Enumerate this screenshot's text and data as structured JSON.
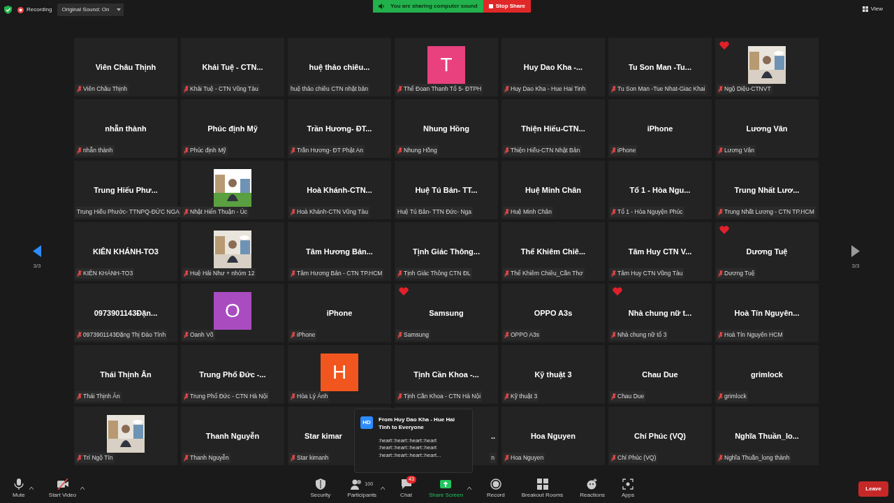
{
  "top_bar": {
    "recording": "Recording",
    "sound_menu": "Original Sound: On",
    "sharing_notice": "You are sharing computer sound",
    "stop_share": "Stop Share",
    "view": "View"
  },
  "pager": {
    "left": "3/3",
    "right": "3/3"
  },
  "tiles": [
    {
      "kind": "name",
      "name": "Viên Châu Thịnh",
      "label": "Viên Châu Thịnh",
      "muted": true,
      "heart": false
    },
    {
      "kind": "name",
      "name": "Khải Tuệ - CTN...",
      "label": "Khải Tuệ - CTN Vũng Tàu",
      "muted": true,
      "heart": false
    },
    {
      "kind": "name",
      "name": "huệ thảo chiêu...",
      "label": "huệ thảo chiêu CTN nhật bản",
      "muted": false,
      "heart": false
    },
    {
      "kind": "avatar",
      "letter": "T",
      "color": "#e8417e",
      "label": "Thể Đoan Thanh  Tổ 5- ĐTPH",
      "muted": true,
      "heart": false
    },
    {
      "kind": "name",
      "name": "Huy Dao Kha -...",
      "label": "Huy Dao Kha - Hue Hai Tinh",
      "muted": true,
      "heart": false
    },
    {
      "kind": "name",
      "name": "Tu Son Man -Tu...",
      "label": "Tu Son Man -Tue Nhat-Giac Khai",
      "muted": true,
      "heart": false
    },
    {
      "kind": "picture",
      "label": "Ngộ Diệu-CTNVT",
      "muted": true,
      "heart": true
    },
    {
      "kind": "name",
      "name": "nhẫn thành",
      "label": "nhẫn thành",
      "muted": true,
      "heart": false
    },
    {
      "kind": "name",
      "name": "Phúc định Mỹ",
      "label": "Phúc định Mỹ",
      "muted": true,
      "heart": false
    },
    {
      "kind": "name",
      "name": "Trần Hương- ĐT...",
      "label": "Trần Hương- ĐT Phật An",
      "muted": true,
      "heart": false
    },
    {
      "kind": "name",
      "name": "Nhung Hồng",
      "label": "Nhung Hồng",
      "muted": true,
      "heart": false
    },
    {
      "kind": "name",
      "name": "Thiện  Hiếu-CTN...",
      "label": "Thiện Hiếu-CTN Nhật Bản",
      "muted": true,
      "heart": false
    },
    {
      "kind": "name",
      "name": "iPhone",
      "label": "iPhone",
      "muted": true,
      "heart": false
    },
    {
      "kind": "name",
      "name": "Lương Vân",
      "label": "Lương Vân",
      "muted": true,
      "heart": false
    },
    {
      "kind": "name",
      "name": "Trung Hiếu Phư...",
      "label": "Trung Hiếu Phước- TTNPQ-ĐỨC NGA",
      "muted": false,
      "heart": false
    },
    {
      "kind": "picture",
      "label": "Nhật Hiển Thuận - Úc",
      "muted": true,
      "heart": false
    },
    {
      "kind": "name",
      "name": "Hoà  Khánh-CTN...",
      "label": "Hoà Khánh-CTN Vũng Tàu",
      "muted": true,
      "heart": false
    },
    {
      "kind": "name",
      "name": "Huệ Tú Bản- TT...",
      "label": "Huệ Tú Bản- TTN Đức- Nga",
      "muted": false,
      "heart": false
    },
    {
      "kind": "name",
      "name": "Huệ Minh Chân",
      "label": "Huệ Minh Chân",
      "muted": true,
      "heart": false
    },
    {
      "kind": "name",
      "name": "Tổ 1 - Hòa Ngu...",
      "label": "Tổ 1 - Hòa Nguyện Phúc",
      "muted": true,
      "heart": false
    },
    {
      "kind": "name",
      "name": "Trung Nhất Lươ...",
      "label": "Trung Nhất Lương - CTN TP.HCM",
      "muted": true,
      "heart": false
    },
    {
      "kind": "name",
      "name": "KIÊN KHÁNH-TO3",
      "label": "KIÊN KHÁNH-TO3",
      "muted": true,
      "heart": false
    },
    {
      "kind": "picture",
      "label": "Huệ Hải Như + nhóm 12",
      "muted": true,
      "heart": false
    },
    {
      "kind": "name",
      "name": "Tâm Hương Bản...",
      "label": "Tâm Hương Bản - CTN TP.HCM",
      "muted": true,
      "heart": false
    },
    {
      "kind": "name",
      "name": "Tịnh Giác Thông...",
      "label": "Tịnh Giác Thông CTN ĐL",
      "muted": true,
      "heart": false
    },
    {
      "kind": "name",
      "name": "Thể Khiêm Chiê...",
      "label": "Thể Khiêm Chiêu_Cần Thơ",
      "muted": true,
      "heart": false
    },
    {
      "kind": "name",
      "name": "Tâm Huy CTN V...",
      "label": "Tâm Huy CTN Vũng Tàu",
      "muted": true,
      "heart": false
    },
    {
      "kind": "name",
      "name": "Dương Tuệ",
      "label": "Dương Tuệ",
      "muted": true,
      "heart": true
    },
    {
      "kind": "name",
      "name": "0973901143Đặn...",
      "label": "0973901143Đặng Thị Đào Tính",
      "muted": true,
      "heart": false
    },
    {
      "kind": "avatar",
      "letter": "O",
      "color": "#a94cc0",
      "label": "Oanh Võ",
      "muted": true,
      "heart": false
    },
    {
      "kind": "name",
      "name": "iPhone",
      "label": "iPhone",
      "muted": true,
      "heart": false
    },
    {
      "kind": "name",
      "name": "Samsung",
      "label": "Samsung",
      "muted": true,
      "heart": true
    },
    {
      "kind": "name",
      "name": "OPPO A3s",
      "label": "OPPO A3s",
      "muted": true,
      "heart": false
    },
    {
      "kind": "name",
      "name": "Nhà chung nữ t...",
      "label": "Nhà chung nữ tổ 3",
      "muted": true,
      "heart": true
    },
    {
      "kind": "name",
      "name": "Hoà Tín Nguyên...",
      "label": "Hoà Tín Nguyên HCM",
      "muted": true,
      "heart": false
    },
    {
      "kind": "name",
      "name": "Thái Thịnh Ân",
      "label": "Thái Thịnh Ân",
      "muted": true,
      "heart": false
    },
    {
      "kind": "name",
      "name": "Trung Phổ Đức -...",
      "label": "Trung Phổ Đức - CTN Hà Nội",
      "muted": true,
      "heart": false
    },
    {
      "kind": "avatar",
      "letter": "H",
      "color": "#f0561d",
      "label": "Hòa Lý Ánh",
      "muted": true,
      "heart": false
    },
    {
      "kind": "name",
      "name": "Tịnh Cần Khoa -...",
      "label": "Tịnh Cần Khoa - CTN Hà Nội",
      "muted": true,
      "heart": false
    },
    {
      "kind": "name",
      "name": "Kỹ thuật 3",
      "label": "Kỹ thuật 3",
      "muted": true,
      "heart": false
    },
    {
      "kind": "name",
      "name": "Chau Due",
      "label": "Chau Due",
      "muted": true,
      "heart": false
    },
    {
      "kind": "name",
      "name": "grimlock",
      "label": "grimlock",
      "muted": true,
      "heart": false
    },
    {
      "kind": "picture",
      "label": "Trí Ngộ Tín",
      "muted": true,
      "heart": false
    },
    {
      "kind": "name",
      "name": "Thanh Nguyễn",
      "label": "Thanh Nguyễn",
      "muted": true,
      "heart": false
    },
    {
      "kind": "clipped",
      "name": "Star kimar",
      "label": "Star kimanh",
      "muted": true,
      "heart": false
    },
    {
      "kind": "covered",
      "name": "..",
      "label": "n",
      "muted": false,
      "heart": false
    },
    {
      "kind": "name",
      "name": "Hoa Nguyen",
      "label": "Hoa Nguyen",
      "muted": true,
      "heart": false
    },
    {
      "kind": "name",
      "name": "Chí Phúc (VQ)",
      "label": "Chí Phúc (VQ)",
      "muted": true,
      "heart": false
    },
    {
      "kind": "name",
      "name": "Nghĩa  Thuần_lo...",
      "label": "Nghĩa Thuần_long thành",
      "muted": true,
      "heart": false
    }
  ],
  "chat_popup": {
    "initials": "HD",
    "title": "From Huy Dao Kha - Hue Hai Tinh to Everyone",
    "lines": [
      ":heart::heart::heart::heart",
      ":heart::heart::heart::heart",
      ":heart::heart::heart::heart..."
    ]
  },
  "toolbar": {
    "left": [
      {
        "kind": "mic",
        "label": "Mute",
        "caret": true
      },
      {
        "kind": "video",
        "label": "Start Video",
        "caret": true
      }
    ],
    "center": [
      {
        "kind": "security",
        "label": "Security",
        "caret": false,
        "highlight": false
      },
      {
        "kind": "participants",
        "label": "Participants",
        "count": "100",
        "caret": true,
        "highlight": false
      },
      {
        "kind": "chat",
        "label": "Chat",
        "badge": "43",
        "caret": false,
        "highlight": false
      },
      {
        "kind": "share",
        "label": "Share Screen",
        "caret": true,
        "highlight": true
      },
      {
        "kind": "record",
        "label": "Record",
        "caret": false,
        "highlight": false
      },
      {
        "kind": "breakout",
        "label": "Breakout Rooms",
        "caret": false,
        "highlight": false
      },
      {
        "kind": "reactions",
        "label": "Reactions",
        "caret": false,
        "highlight": false
      },
      {
        "kind": "apps",
        "label": "Apps",
        "caret": false,
        "highlight": false
      }
    ],
    "leave": "Leave"
  }
}
